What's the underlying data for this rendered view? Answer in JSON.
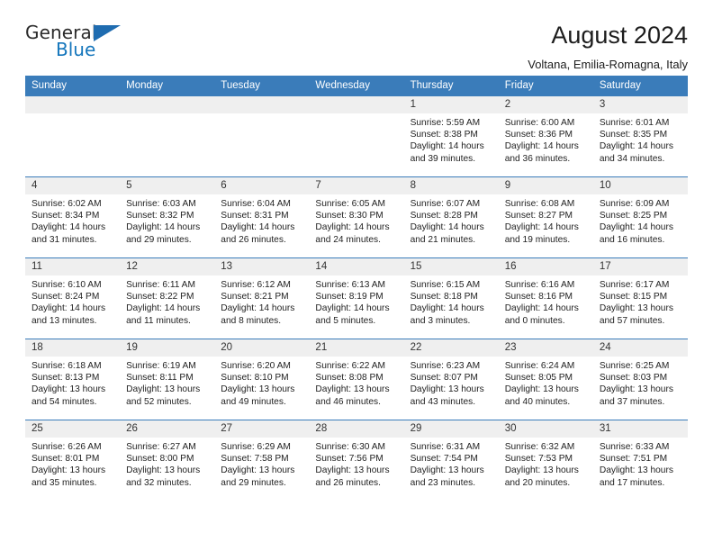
{
  "brand": {
    "name_part1": "General",
    "name_part2": "Blue",
    "accent_color": "#1f6cb0"
  },
  "header": {
    "title": "August 2024",
    "subtitle": "Voltana, Emilia-Romagna, Italy"
  },
  "theme": {
    "header_bg": "#3a7cba",
    "daynum_bg": "#efefef",
    "border": "#3a7cba"
  },
  "weekday_headers": [
    "Sunday",
    "Monday",
    "Tuesday",
    "Wednesday",
    "Thursday",
    "Friday",
    "Saturday"
  ],
  "weeks": [
    [
      {
        "day": "",
        "blank": true
      },
      {
        "day": "",
        "blank": true
      },
      {
        "day": "",
        "blank": true
      },
      {
        "day": "",
        "blank": true
      },
      {
        "day": "1",
        "sunrise": "Sunrise: 5:59 AM",
        "sunset": "Sunset: 8:38 PM",
        "daylight": "Daylight: 14 hours and 39 minutes."
      },
      {
        "day": "2",
        "sunrise": "Sunrise: 6:00 AM",
        "sunset": "Sunset: 8:36 PM",
        "daylight": "Daylight: 14 hours and 36 minutes."
      },
      {
        "day": "3",
        "sunrise": "Sunrise: 6:01 AM",
        "sunset": "Sunset: 8:35 PM",
        "daylight": "Daylight: 14 hours and 34 minutes."
      }
    ],
    [
      {
        "day": "4",
        "sunrise": "Sunrise: 6:02 AM",
        "sunset": "Sunset: 8:34 PM",
        "daylight": "Daylight: 14 hours and 31 minutes."
      },
      {
        "day": "5",
        "sunrise": "Sunrise: 6:03 AM",
        "sunset": "Sunset: 8:32 PM",
        "daylight": "Daylight: 14 hours and 29 minutes."
      },
      {
        "day": "6",
        "sunrise": "Sunrise: 6:04 AM",
        "sunset": "Sunset: 8:31 PM",
        "daylight": "Daylight: 14 hours and 26 minutes."
      },
      {
        "day": "7",
        "sunrise": "Sunrise: 6:05 AM",
        "sunset": "Sunset: 8:30 PM",
        "daylight": "Daylight: 14 hours and 24 minutes."
      },
      {
        "day": "8",
        "sunrise": "Sunrise: 6:07 AM",
        "sunset": "Sunset: 8:28 PM",
        "daylight": "Daylight: 14 hours and 21 minutes."
      },
      {
        "day": "9",
        "sunrise": "Sunrise: 6:08 AM",
        "sunset": "Sunset: 8:27 PM",
        "daylight": "Daylight: 14 hours and 19 minutes."
      },
      {
        "day": "10",
        "sunrise": "Sunrise: 6:09 AM",
        "sunset": "Sunset: 8:25 PM",
        "daylight": "Daylight: 14 hours and 16 minutes."
      }
    ],
    [
      {
        "day": "11",
        "sunrise": "Sunrise: 6:10 AM",
        "sunset": "Sunset: 8:24 PM",
        "daylight": "Daylight: 14 hours and 13 minutes."
      },
      {
        "day": "12",
        "sunrise": "Sunrise: 6:11 AM",
        "sunset": "Sunset: 8:22 PM",
        "daylight": "Daylight: 14 hours and 11 minutes."
      },
      {
        "day": "13",
        "sunrise": "Sunrise: 6:12 AM",
        "sunset": "Sunset: 8:21 PM",
        "daylight": "Daylight: 14 hours and 8 minutes."
      },
      {
        "day": "14",
        "sunrise": "Sunrise: 6:13 AM",
        "sunset": "Sunset: 8:19 PM",
        "daylight": "Daylight: 14 hours and 5 minutes."
      },
      {
        "day": "15",
        "sunrise": "Sunrise: 6:15 AM",
        "sunset": "Sunset: 8:18 PM",
        "daylight": "Daylight: 14 hours and 3 minutes."
      },
      {
        "day": "16",
        "sunrise": "Sunrise: 6:16 AM",
        "sunset": "Sunset: 8:16 PM",
        "daylight": "Daylight: 14 hours and 0 minutes."
      },
      {
        "day": "17",
        "sunrise": "Sunrise: 6:17 AM",
        "sunset": "Sunset: 8:15 PM",
        "daylight": "Daylight: 13 hours and 57 minutes."
      }
    ],
    [
      {
        "day": "18",
        "sunrise": "Sunrise: 6:18 AM",
        "sunset": "Sunset: 8:13 PM",
        "daylight": "Daylight: 13 hours and 54 minutes."
      },
      {
        "day": "19",
        "sunrise": "Sunrise: 6:19 AM",
        "sunset": "Sunset: 8:11 PM",
        "daylight": "Daylight: 13 hours and 52 minutes."
      },
      {
        "day": "20",
        "sunrise": "Sunrise: 6:20 AM",
        "sunset": "Sunset: 8:10 PM",
        "daylight": "Daylight: 13 hours and 49 minutes."
      },
      {
        "day": "21",
        "sunrise": "Sunrise: 6:22 AM",
        "sunset": "Sunset: 8:08 PM",
        "daylight": "Daylight: 13 hours and 46 minutes."
      },
      {
        "day": "22",
        "sunrise": "Sunrise: 6:23 AM",
        "sunset": "Sunset: 8:07 PM",
        "daylight": "Daylight: 13 hours and 43 minutes."
      },
      {
        "day": "23",
        "sunrise": "Sunrise: 6:24 AM",
        "sunset": "Sunset: 8:05 PM",
        "daylight": "Daylight: 13 hours and 40 minutes."
      },
      {
        "day": "24",
        "sunrise": "Sunrise: 6:25 AM",
        "sunset": "Sunset: 8:03 PM",
        "daylight": "Daylight: 13 hours and 37 minutes."
      }
    ],
    [
      {
        "day": "25",
        "sunrise": "Sunrise: 6:26 AM",
        "sunset": "Sunset: 8:01 PM",
        "daylight": "Daylight: 13 hours and 35 minutes."
      },
      {
        "day": "26",
        "sunrise": "Sunrise: 6:27 AM",
        "sunset": "Sunset: 8:00 PM",
        "daylight": "Daylight: 13 hours and 32 minutes."
      },
      {
        "day": "27",
        "sunrise": "Sunrise: 6:29 AM",
        "sunset": "Sunset: 7:58 PM",
        "daylight": "Daylight: 13 hours and 29 minutes."
      },
      {
        "day": "28",
        "sunrise": "Sunrise: 6:30 AM",
        "sunset": "Sunset: 7:56 PM",
        "daylight": "Daylight: 13 hours and 26 minutes."
      },
      {
        "day": "29",
        "sunrise": "Sunrise: 6:31 AM",
        "sunset": "Sunset: 7:54 PM",
        "daylight": "Daylight: 13 hours and 23 minutes."
      },
      {
        "day": "30",
        "sunrise": "Sunrise: 6:32 AM",
        "sunset": "Sunset: 7:53 PM",
        "daylight": "Daylight: 13 hours and 20 minutes."
      },
      {
        "day": "31",
        "sunrise": "Sunrise: 6:33 AM",
        "sunset": "Sunset: 7:51 PM",
        "daylight": "Daylight: 13 hours and 17 minutes."
      }
    ]
  ]
}
